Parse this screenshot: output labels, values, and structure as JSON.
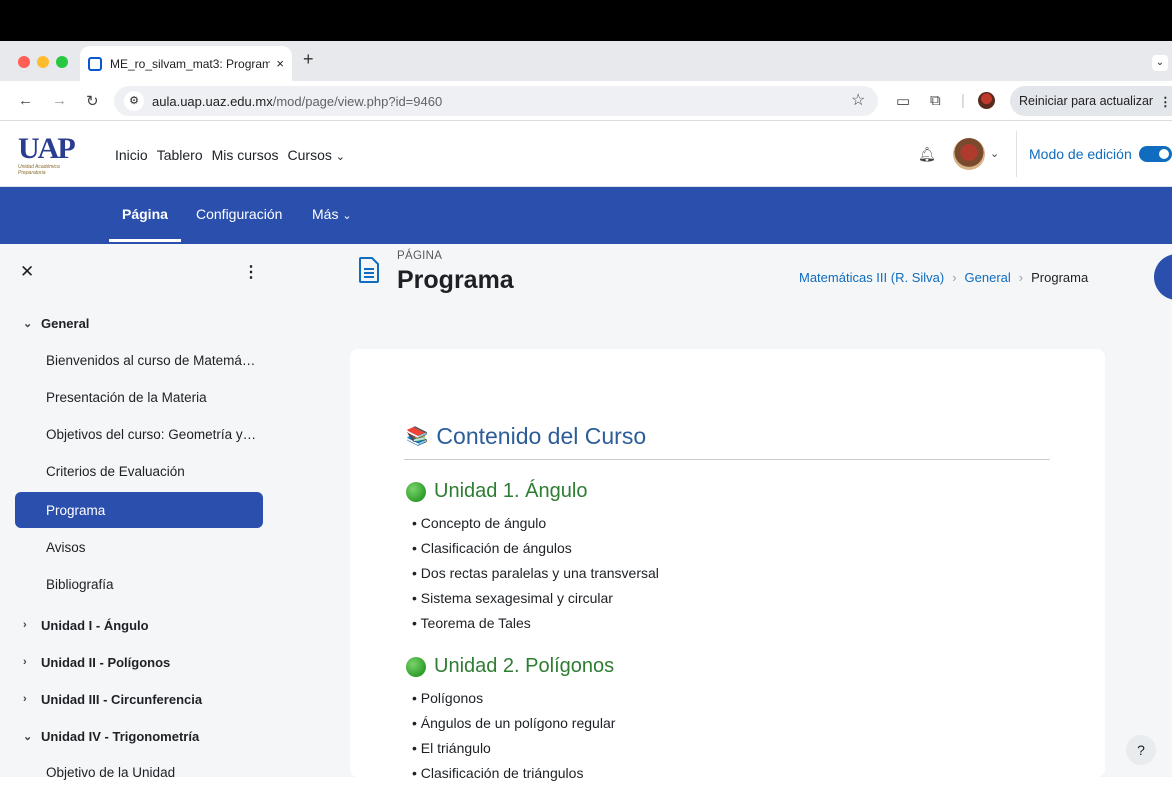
{
  "browser": {
    "tab_title": "ME_ro_silvam_mat3: Program",
    "tab_close": "×",
    "new_tab": "+",
    "url_host": "aula.uap.uaz.edu.mx",
    "url_path": "/mod/page/view.php?id=9460",
    "update_label": "Reiniciar para actualizar",
    "traffic_colors": [
      "#ff5f57",
      "#febc2e",
      "#28c840"
    ]
  },
  "site": {
    "logo_text": "UAP",
    "logo_subtext": "Unidad Académica Preparatoria",
    "nav": [
      "Inicio",
      "Tablero",
      "Mis cursos",
      "Cursos"
    ],
    "edit_mode_label": "Modo de edición"
  },
  "secondary_nav": {
    "items": [
      "Página",
      "Configuración",
      "Más"
    ],
    "active": "Página"
  },
  "drawer": {
    "items": [
      {
        "label": "General",
        "type": "section",
        "expanded": true
      },
      {
        "label": "Bienvenidos al curso de Matemá…",
        "type": "item"
      },
      {
        "label": "Presentación de la Materia",
        "type": "item"
      },
      {
        "label": "Objetivos del curso: Geometría y…",
        "type": "item"
      },
      {
        "label": "Criterios de Evaluación",
        "type": "item"
      },
      {
        "label": "Programa",
        "type": "item",
        "active": true
      },
      {
        "label": "Avisos",
        "type": "item"
      },
      {
        "label": "Bibliografía",
        "type": "item"
      },
      {
        "label": "Unidad I - Ángulo",
        "type": "section",
        "expanded": false
      },
      {
        "label": "Unidad II - Polígonos",
        "type": "section",
        "expanded": false
      },
      {
        "label": "Unidad III - Circunferencia",
        "type": "section",
        "expanded": false
      },
      {
        "label": "Unidad IV - Trigonometría",
        "type": "section",
        "expanded": true
      },
      {
        "label": "Objetivo de la Unidad",
        "type": "item"
      }
    ]
  },
  "page": {
    "kicker": "PÁGINA",
    "title": "Programa",
    "breadcrumb": [
      "Matemáticas III (R. Silva)",
      "General",
      "Programa"
    ]
  },
  "content": {
    "heading": "Contenido del Curso",
    "heading_icon": "📚",
    "units": [
      {
        "title": "Unidad 1. Ángulo",
        "topics": [
          "Concepto de ángulo",
          "Clasificación de ángulos",
          "Dos rectas paralelas y una transversal",
          "Sistema sexagesimal y circular",
          "Teorema de Tales"
        ]
      },
      {
        "title": "Unidad 2. Polígonos",
        "topics": [
          "Polígonos",
          "Ángulos de un polígono regular",
          "El triángulo",
          "Clasificación de triángulos"
        ]
      }
    ]
  },
  "help_label": "?"
}
